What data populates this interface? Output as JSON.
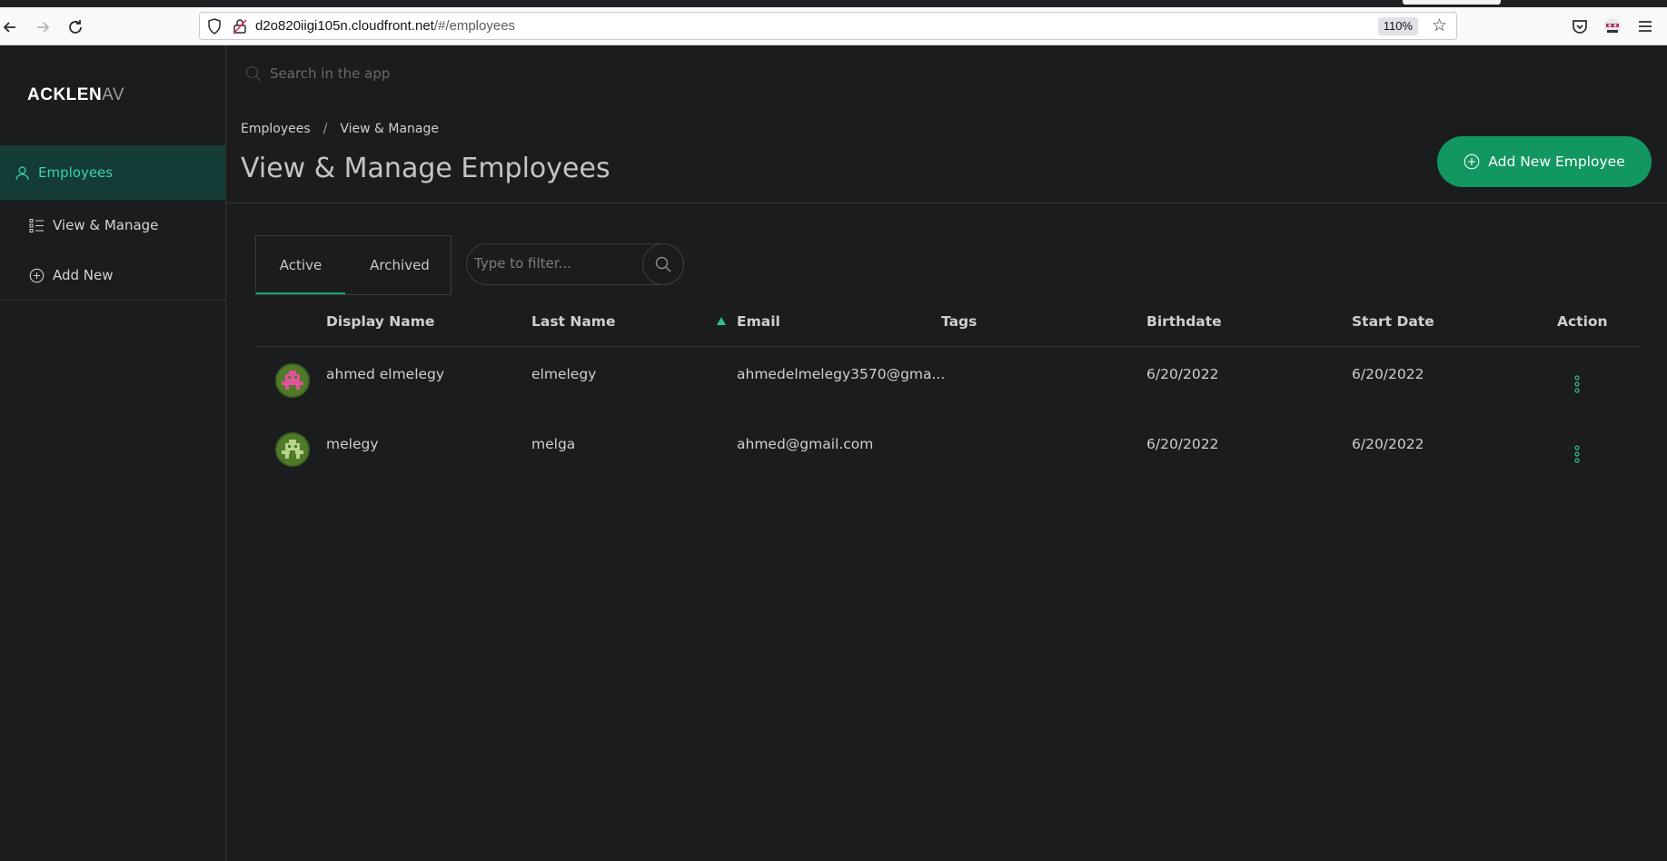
{
  "browser": {
    "url_host": "d2o820iigi105n.cloudfront.net",
    "url_path": "/#/employees",
    "zoom": "110%"
  },
  "sidebar": {
    "logo_bold": "ACKLEN",
    "logo_fade": "AV",
    "active_item": "Employees",
    "items": [
      {
        "label": "View & Manage"
      },
      {
        "label": "Add New"
      }
    ]
  },
  "search": {
    "placeholder": "Search in the app"
  },
  "breadcrumb": {
    "root": "Employees",
    "separator": "/",
    "current": "View & Manage"
  },
  "page": {
    "title": "View & Manage Employees",
    "add_button_label": "Add New Employee"
  },
  "tabs": [
    {
      "label": "Active",
      "active": true
    },
    {
      "label": "Archived",
      "active": false
    }
  ],
  "filter": {
    "placeholder": "Type to filter..."
  },
  "table": {
    "columns": [
      "Display Name",
      "Last Name",
      "Email",
      "Tags",
      "Birthdate",
      "Start Date",
      "Action"
    ],
    "sorted_column": "Email",
    "rows": [
      {
        "display_name": "ahmed elmelegy",
        "last_name": "elmelegy",
        "email": "ahmedelmelegy3570@gma...",
        "tags": "",
        "birthdate": "6/20/2022",
        "start_date": "6/20/2022",
        "avatar_color": "#e0539a"
      },
      {
        "display_name": "melegy",
        "last_name": "melga",
        "email": "ahmed@gmail.com",
        "tags": "",
        "birthdate": "6/20/2022",
        "start_date": "6/20/2022",
        "avatar_color": "#b9d38a"
      }
    ]
  },
  "colors": {
    "accent": "#11975f",
    "accent_text": "#38d3a6",
    "active_bg": "#153b36",
    "background": "#1b1c1e"
  }
}
